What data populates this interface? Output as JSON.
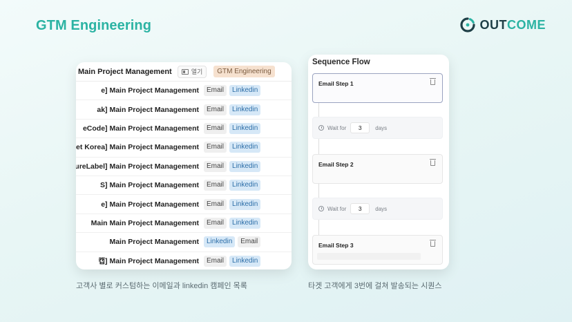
{
  "header": {
    "title": "GTM Engineering",
    "brand_prefix": "OUT",
    "brand_suffix": "COME"
  },
  "table": {
    "header_name": "Main Project Management",
    "open_label": "열기",
    "header_tag": "GTM Engineering",
    "rows": [
      {
        "name": "e] Main Project Management",
        "tags": [
          "Email",
          "Linkedin"
        ]
      },
      {
        "name": "ak] Main Project Management",
        "tags": [
          "Email",
          "Linkedin"
        ]
      },
      {
        "name": "eCode] Main Project Management",
        "tags": [
          "Email",
          "Linkedin"
        ]
      },
      {
        "name": "et Korea] Main Project Management",
        "tags": [
          "Email",
          "Linkedin"
        ]
      },
      {
        "name": "ureLabel] Main Project Management",
        "tags": [
          "Email",
          "Linkedin"
        ]
      },
      {
        "name": "S] Main Project Management",
        "tags": [
          "Email",
          "Linkedin"
        ]
      },
      {
        "name": "e] Main Project Management",
        "tags": [
          "Email",
          "Linkedin"
        ]
      },
      {
        "name": "Main Main Project Management",
        "tags": [
          "Email",
          "Linkedin"
        ]
      },
      {
        "name": "Main Project Management",
        "tags": [
          "Linkedin",
          "Email"
        ]
      },
      {
        "name": "캡] Main Project Management",
        "tags": [
          "Email",
          "Linkedin"
        ]
      }
    ],
    "caption": "고객사 별로 커스텀하는 이메일과  linkedin 캠페인 목록"
  },
  "sequence": {
    "title": "Sequence Flow",
    "steps": [
      {
        "label": "Email Step 1"
      },
      {
        "label": "Email Step 2"
      },
      {
        "label": "Email Step 3"
      }
    ],
    "waits": [
      {
        "prefix": "Wait for",
        "value": "3",
        "unit": "days"
      },
      {
        "prefix": "Wait for",
        "value": "3",
        "unit": "days"
      }
    ],
    "caption": "타겟 고객에게 3번에 걸쳐 발송되는 시퀀스"
  },
  "colors": {
    "accent": "#2bb3a3",
    "brand_dark": "#1f3f47",
    "linkedin_tag": "#d6e8f7",
    "email_tag": "#efefef",
    "header_tag": "#f6e1cf"
  }
}
